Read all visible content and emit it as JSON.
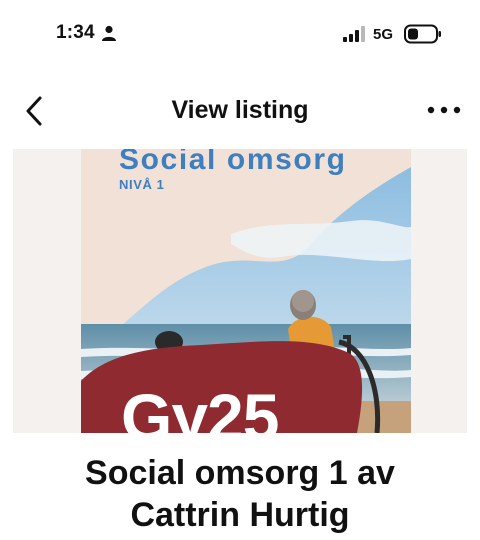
{
  "status_bar": {
    "time": "1:34",
    "network": "5G",
    "icons": [
      "person-icon",
      "signal-icon",
      "battery-icon"
    ]
  },
  "nav": {
    "title": "View listing",
    "back_icon": "chevron-left-icon",
    "more_icon": "more-horizontal-icon"
  },
  "book_cover": {
    "series_title": "Social omsorg",
    "level": "NIVÅ 1",
    "code": "Gy25"
  },
  "listing": {
    "title_line1": "Social omsorg 1 av",
    "title_line2": "Cattrin Hurtig"
  },
  "colors": {
    "cover_blue": "#3d7fbf",
    "cover_red": "#8f2a30",
    "text": "#111111"
  }
}
